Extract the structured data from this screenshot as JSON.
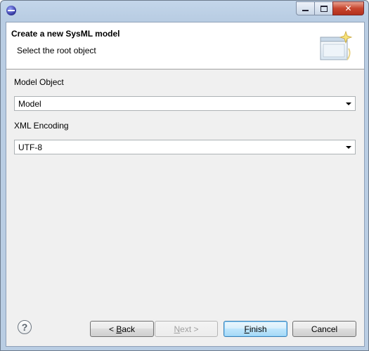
{
  "titlebar": {
    "title": "",
    "icon": "eclipse-icon"
  },
  "header": {
    "title": "Create a new SysML model",
    "subtitle": "Select the root object"
  },
  "form": {
    "model_object_label": "Model Object",
    "model_object_value": "Model",
    "xml_encoding_label": "XML Encoding",
    "xml_encoding_value": "UTF-8"
  },
  "buttons": {
    "help_glyph": "?",
    "back_mnemonic": "B",
    "back_rest": "ack",
    "back_prefix": "< ",
    "next_prefix": "",
    "next_mnemonic": "N",
    "next_rest": "ext >",
    "finish_mnemonic": "F",
    "finish_rest": "inish",
    "cancel": "Cancel"
  },
  "colors": {
    "title_bar": "#b9cde3",
    "default_button": "#bee6fd",
    "close_button": "#c7452e"
  }
}
